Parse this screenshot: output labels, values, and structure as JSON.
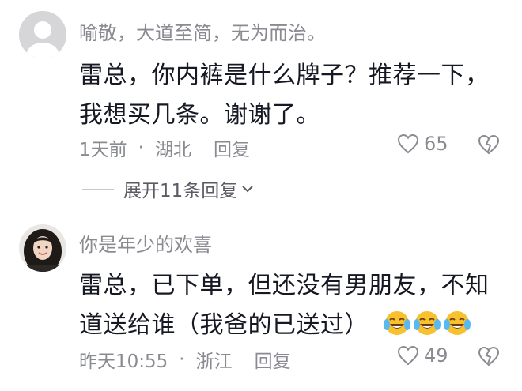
{
  "comments": [
    {
      "username": "喻敬，大道至简，无为而治。",
      "lines": [
        "雷总，你内裤是什么牌子？推荐一下，",
        "我想买几条。谢谢了。"
      ],
      "time": "1天前",
      "location": "湖北",
      "reply_label": "回复",
      "likes": "65",
      "expand_label": "展开11条回复",
      "avatar_icon": "default-avatar-icon"
    },
    {
      "username": "你是年少的欢喜",
      "lines": [
        "雷总，已下单，但还没有男朋友，不知",
        "道送给谁（我爸的已送过）"
      ],
      "emoji": [
        "tears-of-joy-icon",
        "tears-of-joy-icon",
        "tears-of-joy-icon"
      ],
      "time": "昨天10:55",
      "location": "浙江",
      "reply_label": "回复",
      "likes": "49",
      "avatar_icon": "user-photo-avatar"
    }
  ],
  "separator": "·",
  "colors": {
    "text": "#161823",
    "secondary": "#8a8b91",
    "emoji_face": "#f9c12e"
  }
}
